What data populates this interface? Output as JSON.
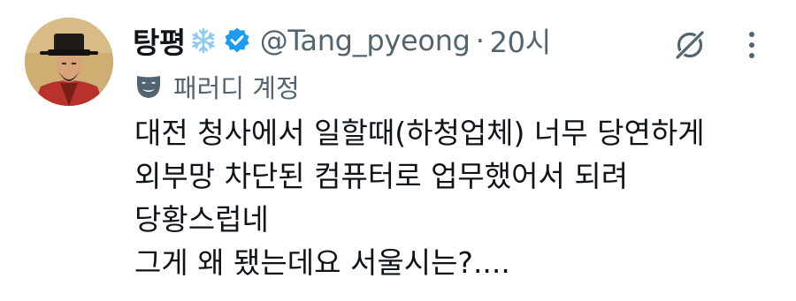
{
  "tweet": {
    "author": {
      "display_name": "탕평",
      "name_emoji": "snowflake",
      "verified": true,
      "handle": "@Tang_pyeong",
      "separator": "·",
      "timestamp": "20시"
    },
    "parody_label": "패러디 계정",
    "text_lines": [
      "대전 청사에서 일할때(하청업체) 너무 당연하게",
      "외부망 차단된 컴퓨터로 업무했어서 되려",
      "당황스럽네",
      "그게 왜 됐는데요 서울시는?...."
    ]
  },
  "icons": {
    "snowflake": "snowflake-icon",
    "verified": "verified-badge-icon",
    "parody": "theater-mask-icon",
    "grok": "grok-icon",
    "more": "more-dots-icon"
  },
  "colors": {
    "verified_blue": "#1d9bf0",
    "snowflake_blue": "#8ec9ee",
    "text": "#0f1419",
    "secondary_text": "#536471"
  }
}
